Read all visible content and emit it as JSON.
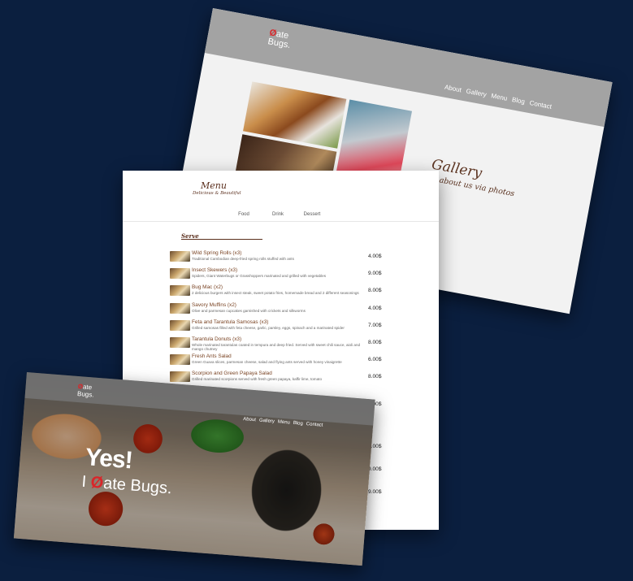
{
  "gallery": {
    "logo_line1_mark": "Ø",
    "logo_line1_rest": "ate",
    "logo_line2": "Bugs.",
    "nav": [
      "About",
      "Gallery",
      "Menu",
      "Blog",
      "Contact"
    ],
    "title": "Gallery",
    "subtitle": "More about us via photos"
  },
  "menu": {
    "title": "Menu",
    "subtitle": "Delicious & Beautiful",
    "tabs": [
      "Food",
      "Drink",
      "Dessert"
    ],
    "active_tab": "Food",
    "section": "Serve",
    "items": [
      {
        "name": "Wild Spring Rolls (x3)",
        "desc": "Traditional Cambodian deep-fried spring rolls stuffed with ants",
        "price": "4.00$"
      },
      {
        "name": "Insect Skewers (x3)",
        "desc": "Spiders, Giant Waterbugs or Grasshoppers marinated and grilled with vegetables",
        "price": "9.00$"
      },
      {
        "name": "Bug Mac (x2)",
        "desc": "2 delicious burgers with insect steak, sweet potato fries, homemade bread and 2 different seasonings",
        "price": "8.00$"
      },
      {
        "name": "Savory Muffins (x2)",
        "desc": "Olive and parmesan cupcakes garnished with crickets and silkworms",
        "price": "4.00$"
      },
      {
        "name": "Feta and Tarantula Samosas (x3)",
        "desc": "Grilled samosas filled with feta cheese, garlic, parsley, eggs, spinach and a marinated spider",
        "price": "7.00$"
      },
      {
        "name": "Tarantula Donuts (x3)",
        "desc": "Whole marinated tarantulas coated in tempura and deep fried. Served with sweet chili sauce, aioli and mango chutney",
        "price": "8.00$"
      },
      {
        "name": "Fresh Ants Salad",
        "desc": "Green Guava slices, parmesan cheese, salad and flying ants served with honey vinaigrette",
        "price": "6.00$"
      },
      {
        "name": "Scorpion and Green Papaya Salad",
        "desc": "Grilled marinated scorpions served with fresh green papaya, kaffir lime, tomato",
        "price": "8.00$"
      }
    ],
    "tail_prices": [
      "9.00$",
      "8.00$",
      "9.00$",
      "9.00$"
    ]
  },
  "home": {
    "logo_line1_mark": "Ø",
    "logo_line1_rest": "ate",
    "logo_line2": "Bugs.",
    "nav": [
      "About",
      "Gallery",
      "Menu",
      "Blog",
      "Contact"
    ],
    "headline": "Yes!",
    "tagline_prefix": "I ",
    "tagline_mark": "Ø",
    "tagline_rest": "ate Bugs."
  }
}
